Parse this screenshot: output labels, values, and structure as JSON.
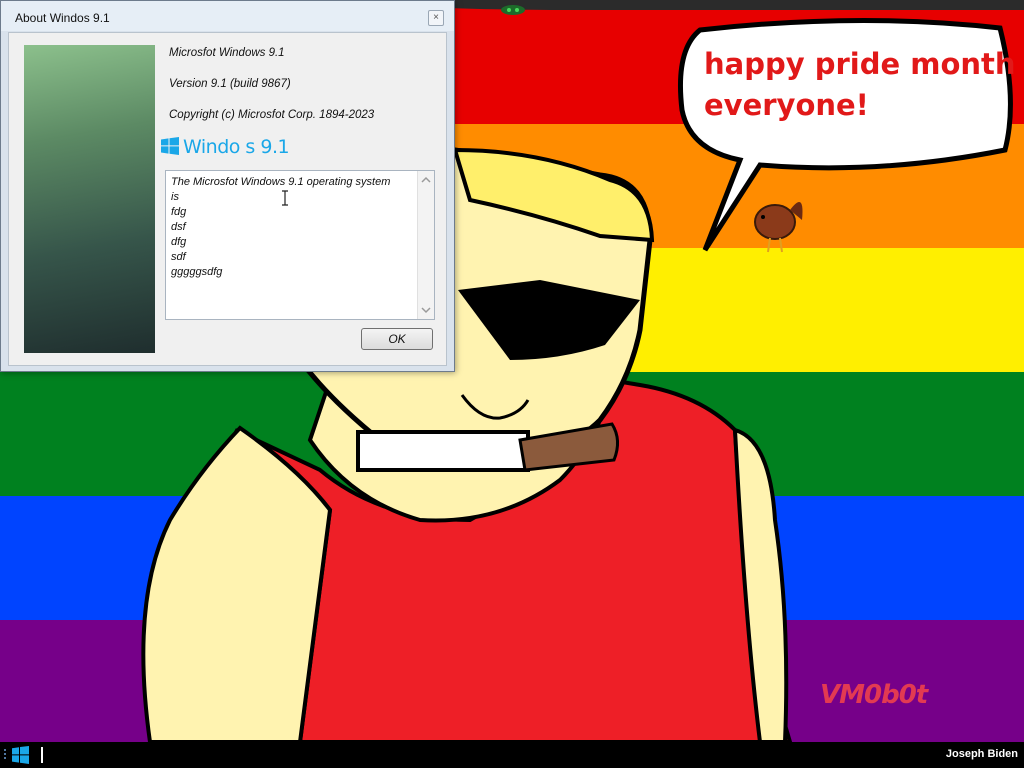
{
  "window": {
    "title": "About Windos 9.1",
    "close_label": "×"
  },
  "about": {
    "product_line": "Microsfot Windows 9.1",
    "version_line": "Version 9.1 (build 9867)",
    "copyright_line": "Copyright (c) Microsfot Corp. 1894-2023",
    "logo_text": "Windo  s 9.1",
    "description_lines": [
      "The Microsfot Windows 9.1 operating system",
      "is",
      "fdg",
      "dsf",
      "dfg",
      "sdf",
      "gggggsdfg"
    ],
    "ok_label": "OK"
  },
  "wallpaper": {
    "speech_line1": "happy pride month",
    "speech_line2": "everyone!",
    "watermark": "VM0b0t",
    "stripe_colors": [
      "#e70000",
      "#ff8c00",
      "#ffef00",
      "#00811f",
      "#0044ff",
      "#760089"
    ]
  },
  "taskbar": {
    "user": "Joseph Biden"
  }
}
